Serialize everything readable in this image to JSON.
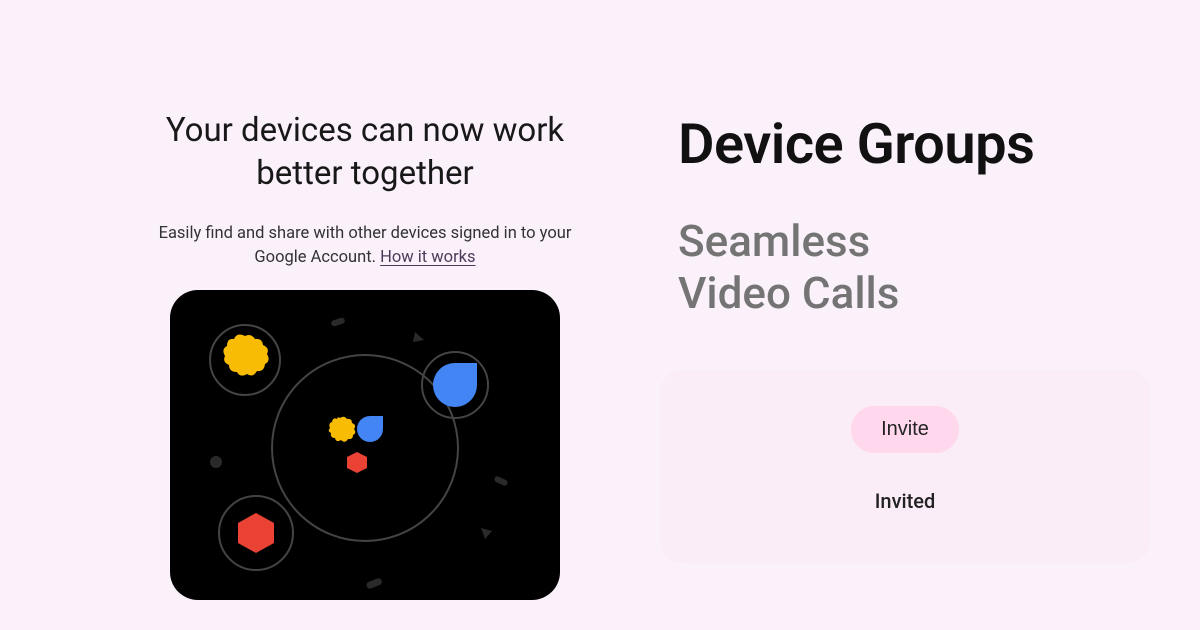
{
  "left": {
    "heading": "Your devices can now work better together",
    "subtext_prefix": "Easily find and share with other devices signed in to your Google Account. ",
    "how_link": "How it works"
  },
  "right": {
    "title": "Device Groups",
    "subtitle_line1": "Seamless",
    "subtitle_line2": "Video Calls",
    "invite_label": "Invite",
    "invited_label": "Invited"
  },
  "colors": {
    "background": "#faf1fb",
    "panel": "#fbedf7",
    "invite_bg": "#ffd8ee",
    "subtitle": "#747474"
  }
}
